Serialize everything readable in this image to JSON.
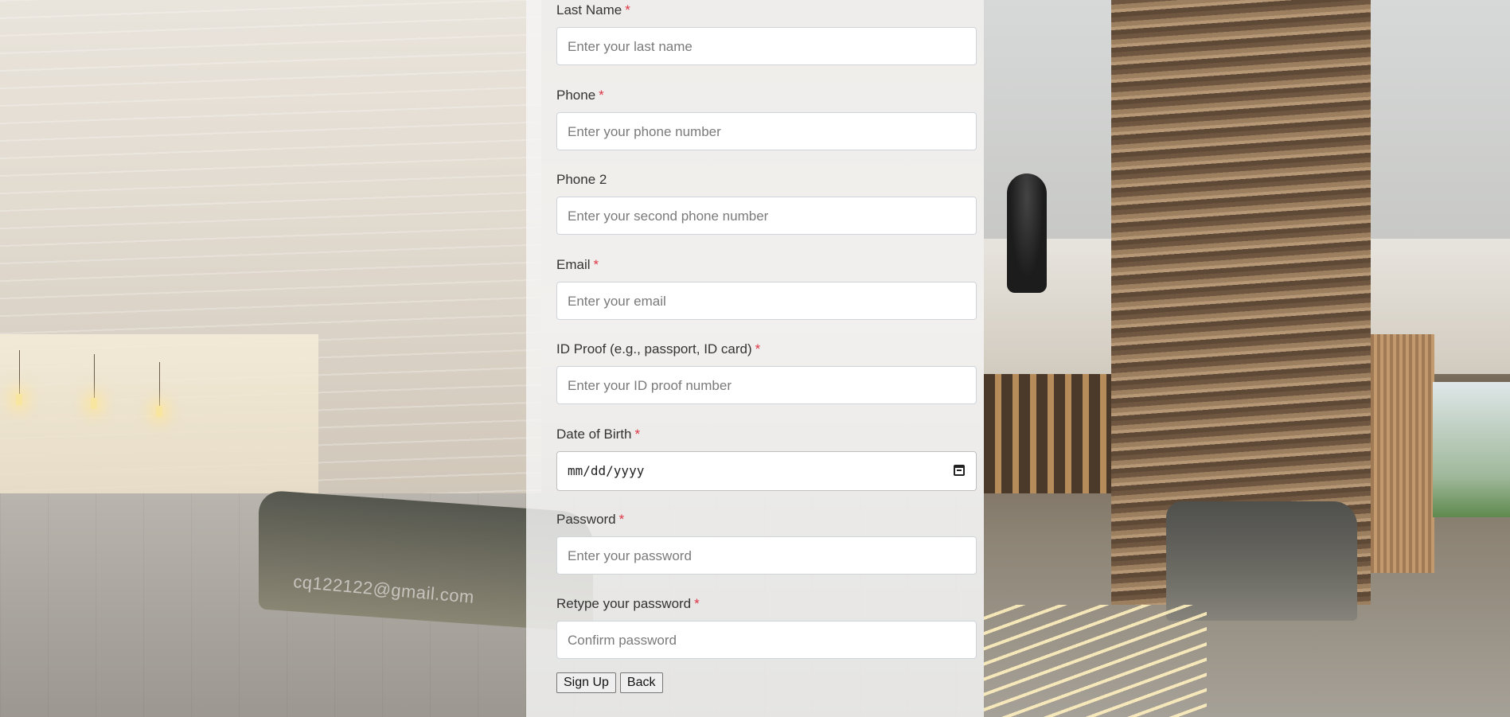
{
  "background": {
    "watermark_text": "cq122122@gmail.com"
  },
  "form": {
    "fields": [
      {
        "label": "Last Name",
        "required": true,
        "placeholder": "Enter your last name"
      },
      {
        "label": "Phone",
        "required": true,
        "placeholder": "Enter your phone number"
      },
      {
        "label": "Phone 2",
        "required": false,
        "placeholder": "Enter your second phone number"
      },
      {
        "label": "Email",
        "required": true,
        "placeholder": "Enter your email"
      },
      {
        "label": "ID Proof (e.g., passport, ID card)",
        "required": true,
        "placeholder": "Enter your ID proof number"
      },
      {
        "label": "Date of Birth",
        "required": true,
        "value": "mm/dd/yyyy"
      },
      {
        "label": "Password",
        "required": true,
        "placeholder": "Enter your password"
      },
      {
        "label": "Retype your password",
        "required": true,
        "placeholder": "Confirm password"
      }
    ],
    "required_marker": "*",
    "buttons": {
      "signup": "Sign Up",
      "back": "Back"
    }
  },
  "colors": {
    "required_marker": "#dc3545",
    "panel_background": "rgba(245,245,245,0.82)"
  },
  "icons": {
    "date_picker": "calendar-icon"
  }
}
